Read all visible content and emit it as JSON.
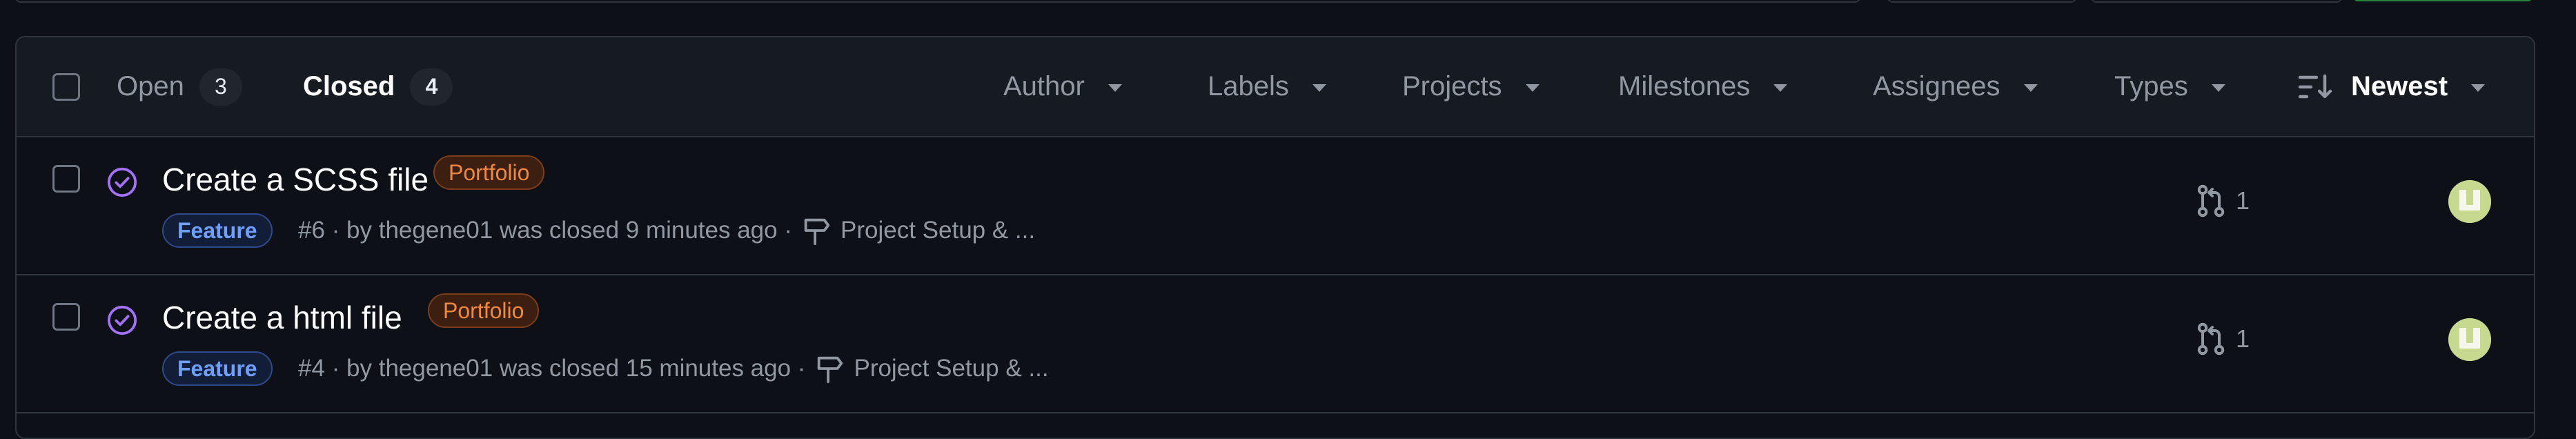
{
  "header": {
    "tabs": {
      "open_label": "Open",
      "open_count": "3",
      "closed_label": "Closed",
      "closed_count": "4"
    },
    "filters": {
      "author": "Author",
      "labels": "Labels",
      "projects": "Projects",
      "milestones": "Milestones",
      "assignees": "Assignees",
      "types": "Types",
      "sort": "Newest"
    }
  },
  "issues": [
    {
      "title": "Create a SCSS file",
      "label": "Portfolio",
      "type": "Feature",
      "meta": "#6 · by thegene01 was closed 9 minutes ago ·",
      "milestone": "Project Setup & ...",
      "linked_prs": "1"
    },
    {
      "title": "Create a html file",
      "label": "Portfolio",
      "type": "Feature",
      "meta": "#4 · by thegene01 was closed 15 minutes ago ·",
      "milestone": "Project Setup & ...",
      "linked_prs": "1"
    }
  ],
  "colors": {
    "background": "#0d1117",
    "header_bg": "#161b22",
    "border": "#30363d",
    "closed_purple": "#a371f7",
    "portfolio_label": "#f0883e",
    "feature_label": "#6f9ffc"
  },
  "icons": {
    "state": "issue-closed-icon",
    "milestone": "milestone-icon",
    "pr": "git-pull-request-icon",
    "sort": "sort-desc-icon"
  }
}
